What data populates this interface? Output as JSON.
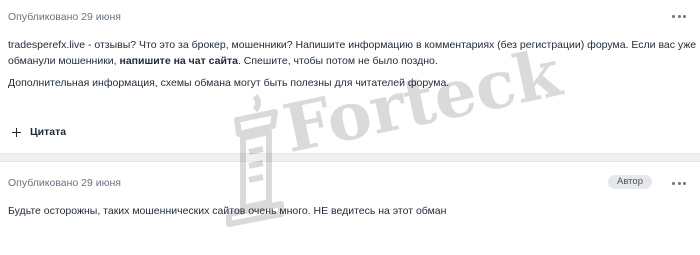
{
  "posts": [
    {
      "published": "Опубликовано 29 июня",
      "paragraphs": [
        {
          "text_before": "tradesperefx.live - отзывы? Что это за брокер, мошенники? Напишите информацию в комментариях (без регистрации) форума. Если вас уже обманули мошенники, ",
          "bold": "напишите на чат сайта",
          "text_after": ". Спешите, чтобы потом не было поздно."
        },
        {
          "text": "Дополнительная информация, схемы обмана могут быть полезны для читателей форума."
        }
      ],
      "quote_label": "Цитата",
      "menu_icon": "more-horizontal-icon"
    },
    {
      "published": "Опубликовано 29 июня",
      "badge": "Автор",
      "text": "Будьте осторожны, таких мошеннических сайтов очень много. НЕ ведитесь на этот обман",
      "menu_icon": "more-horizontal-icon"
    }
  ],
  "watermark": {
    "text": "Forteck",
    "icon": "podium-logo-icon"
  }
}
